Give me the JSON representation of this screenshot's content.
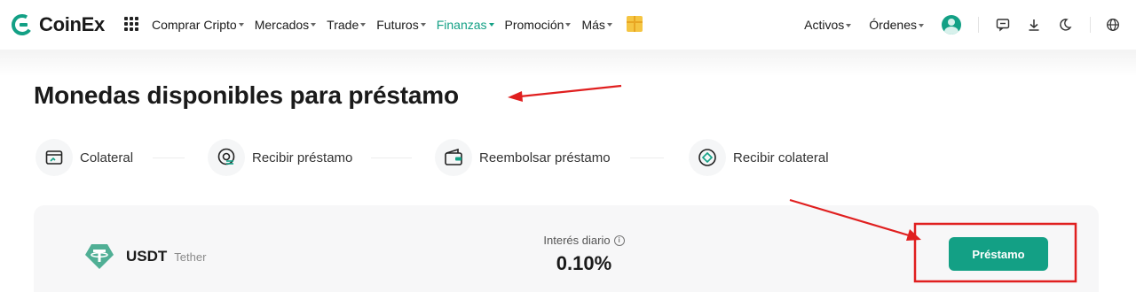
{
  "brand": {
    "name": "CoinEx",
    "color": "#13a085"
  },
  "nav": {
    "items": [
      {
        "label": "Comprar Cripto",
        "active": false
      },
      {
        "label": "Mercados",
        "active": false
      },
      {
        "label": "Trade",
        "active": false
      },
      {
        "label": "Futuros",
        "active": false
      },
      {
        "label": "Finanzas",
        "active": true
      },
      {
        "label": "Promoción",
        "active": false
      },
      {
        "label": "Más",
        "active": false
      }
    ]
  },
  "right_nav": {
    "assets": "Activos",
    "orders": "Órdenes"
  },
  "page": {
    "title": "Monedas disponibles para préstamo"
  },
  "steps": [
    {
      "label": "Colateral",
      "icon": "wallet-icon"
    },
    {
      "label": "Recibir préstamo",
      "icon": "coin-receive-icon"
    },
    {
      "label": "Reembolsar préstamo",
      "icon": "wallet-repay-icon"
    },
    {
      "label": "Recibir colateral",
      "icon": "diamond-coin-icon"
    }
  ],
  "card": {
    "coin_symbol": "USDT",
    "coin_name": "Tether",
    "rate_label": "Interés diario",
    "rate_value": "0.10%",
    "button_label": "Préstamo",
    "coin_color": "#50af95"
  },
  "annotation_color": "#e01f1f"
}
